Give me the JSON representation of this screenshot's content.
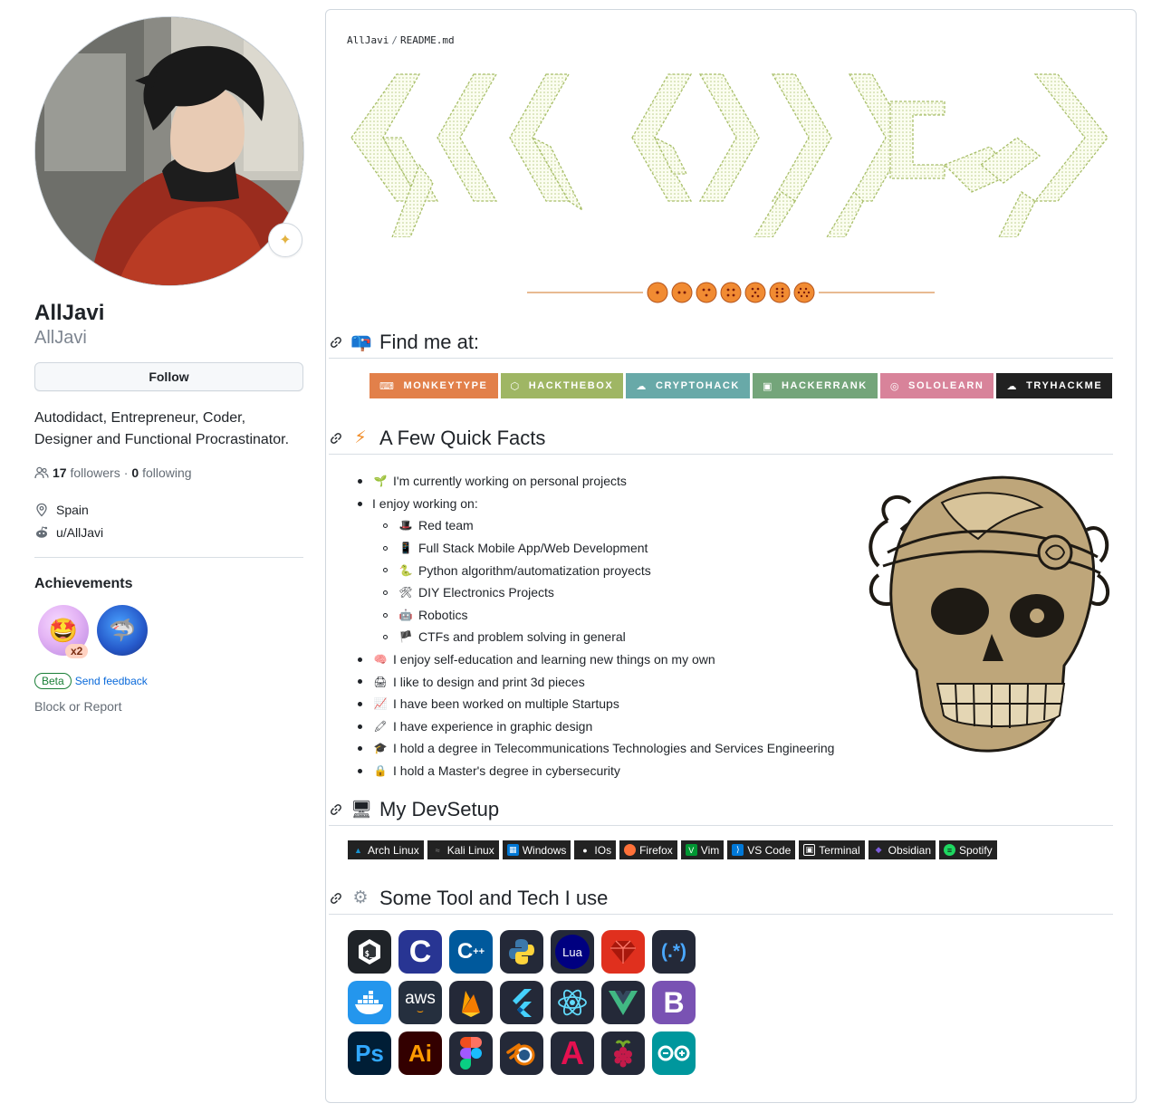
{
  "profile": {
    "fullname": "AllJavi",
    "username": "AllJavi",
    "follow_label": "Follow",
    "bio": "Autodidact, Entrepreneur, Coder, Designer and Functional Procrastinator.",
    "followers_count": "17",
    "followers_label": "followers",
    "following_sep": "·",
    "following_count": "0",
    "following_label": "following",
    "location": "Spain",
    "reddit": "u/AllJavi",
    "achievements_title": "Achievements",
    "achievement_multiplier": "x2",
    "beta_label": "Beta",
    "feedback_label": "Send feedback",
    "block_label": "Block or Report"
  },
  "readme": {
    "crumb_user": "AllJavi",
    "crumb_sep": "/",
    "crumb_file": "README.md",
    "sections": {
      "find": "Find me at:",
      "facts": "A Few Quick Facts",
      "devsetup": "My DevSetup",
      "tools": "Some Tool and Tech I use"
    },
    "profiles": [
      {
        "label": "MONKEYTYPE",
        "color": "#e2804a",
        "icon": "keyboard-icon"
      },
      {
        "label": "HACKTHEBOX",
        "color": "#9fb664",
        "icon": "cube-icon"
      },
      {
        "label": "CRYPTOHACK",
        "color": "#68a9a8",
        "icon": "hat-icon"
      },
      {
        "label": "HACKERRANK",
        "color": "#74a57a",
        "icon": "hackerrank-icon"
      },
      {
        "label": "SOLOLEARN",
        "color": "#d8839a",
        "icon": "sololearn-icon"
      },
      {
        "label": "TRYHACKME",
        "color": "#212121",
        "icon": "cloud-icon"
      }
    ],
    "facts": [
      {
        "level": 1,
        "emoji": "🌱",
        "text": "I'm currently working on personal projects"
      },
      {
        "level": 1,
        "emoji": "",
        "text": "I enjoy working on:"
      },
      {
        "level": 2,
        "emoji": "🎩",
        "text": "Red team"
      },
      {
        "level": 2,
        "emoji": "📱",
        "text": "Full Stack Mobile App/Web Development"
      },
      {
        "level": 2,
        "emoji": "🐍",
        "text": "Python algorithm/automatization proyects"
      },
      {
        "level": 2,
        "emoji": "🛠",
        "text": "DIY Electronics Projects"
      },
      {
        "level": 2,
        "emoji": "🤖",
        "text": "Robotics"
      },
      {
        "level": 2,
        "emoji": "🏴",
        "text": "CTFs and problem solving in general"
      },
      {
        "level": 1,
        "emoji": "🧠",
        "text": "I enjoy self-education and learning new things on my own"
      },
      {
        "level": 1,
        "emoji": "🖨",
        "text": "I like to design and print 3d pieces"
      },
      {
        "level": 1,
        "emoji": "📈",
        "text": "I have been worked on multiple Startups"
      },
      {
        "level": 1,
        "emoji": "🖍",
        "text": "I have experience in graphic design"
      },
      {
        "level": 1,
        "emoji": "🎓",
        "text": "I hold a degree in Telecommunications Technologies and Services Engineering"
      },
      {
        "level": 1,
        "emoji": "🔒",
        "text": "I hold a Master's degree in cybersecurity"
      }
    ],
    "devsetup": [
      {
        "label": "Arch Linux",
        "icon_color": "#1793d1",
        "glyph": "▲"
      },
      {
        "label": "Kali Linux",
        "icon_color": "#555555",
        "glyph": "≈"
      },
      {
        "label": "Windows",
        "icon_color": "#0078d6",
        "glyph": "▦"
      },
      {
        "label": "IOs",
        "icon_color": "#222222",
        "glyph": ""
      },
      {
        "label": "Firefox",
        "icon_color": "#ff7139",
        "glyph": "●"
      },
      {
        "label": "Vim",
        "icon_color": "#019733",
        "glyph": "V"
      },
      {
        "label": "VS Code",
        "icon_color": "#0078d7",
        "glyph": "⟩"
      },
      {
        "label": "Terminal",
        "icon_color": "#4d4d4d",
        "glyph": "▣"
      },
      {
        "label": "Obsidian",
        "icon_color": "#483699",
        "glyph": "◆"
      },
      {
        "label": "Spotify",
        "icon_color": "#1ed760",
        "glyph": "≡"
      }
    ],
    "tools": [
      {
        "name": "bash-icon",
        "bg": "#1f2328",
        "fg": "#ffffff",
        "text": "$"
      },
      {
        "name": "c-icon",
        "bg": "#283593",
        "fg": "#ffffff",
        "text": "C"
      },
      {
        "name": "cplusplus-icon",
        "bg": "#00599c",
        "fg": "#ffffff",
        "text": "C++"
      },
      {
        "name": "python-icon",
        "bg": "#242938",
        "fg": "#ffd43b",
        "text": "Py"
      },
      {
        "name": "lua-icon",
        "bg": "#1b1c6e",
        "fg": "#ffffff",
        "text": "Lua"
      },
      {
        "name": "ruby-icon",
        "bg": "#e0301e",
        "fg": "#ffffff",
        "text": "◆"
      },
      {
        "name": "regex-icon",
        "bg": "#242938",
        "fg": "#4aa8ff",
        "text": "(.*)"
      },
      {
        "name": "docker-icon",
        "bg": "#2496ed",
        "fg": "#ffffff",
        "text": "🐳"
      },
      {
        "name": "aws-icon",
        "bg": "#252f3e",
        "fg": "#ffffff",
        "text": "aws"
      },
      {
        "name": "firebase-icon",
        "bg": "#242938",
        "fg": "#ffca28",
        "text": "▲"
      },
      {
        "name": "flutter-icon",
        "bg": "#242938",
        "fg": "#45d1fd",
        "text": "◣"
      },
      {
        "name": "react-icon",
        "bg": "#242938",
        "fg": "#61dafb",
        "text": "⚛"
      },
      {
        "name": "vue-icon",
        "bg": "#242938",
        "fg": "#41b883",
        "text": "V"
      },
      {
        "name": "bootstrap-icon",
        "bg": "#7952b3",
        "fg": "#ffffff",
        "text": "B"
      },
      {
        "name": "photoshop-icon",
        "bg": "#001e36",
        "fg": "#31a8ff",
        "text": "Ps"
      },
      {
        "name": "illustrator-icon",
        "bg": "#330000",
        "fg": "#ff9a00",
        "text": "Ai"
      },
      {
        "name": "figma-icon",
        "bg": "#242938",
        "fg": "#ff7262",
        "text": "❖"
      },
      {
        "name": "blender-icon",
        "bg": "#242938",
        "fg": "#ea7600",
        "text": "◉"
      },
      {
        "name": "autocad-icon",
        "bg": "#242938",
        "fg": "#e51050",
        "text": "A"
      },
      {
        "name": "raspberrypi-icon",
        "bg": "#242938",
        "fg": "#c51a4a",
        "text": "✿"
      },
      {
        "name": "arduino-icon",
        "bg": "#00979d",
        "fg": "#ffffff",
        "text": "∞"
      }
    ]
  }
}
